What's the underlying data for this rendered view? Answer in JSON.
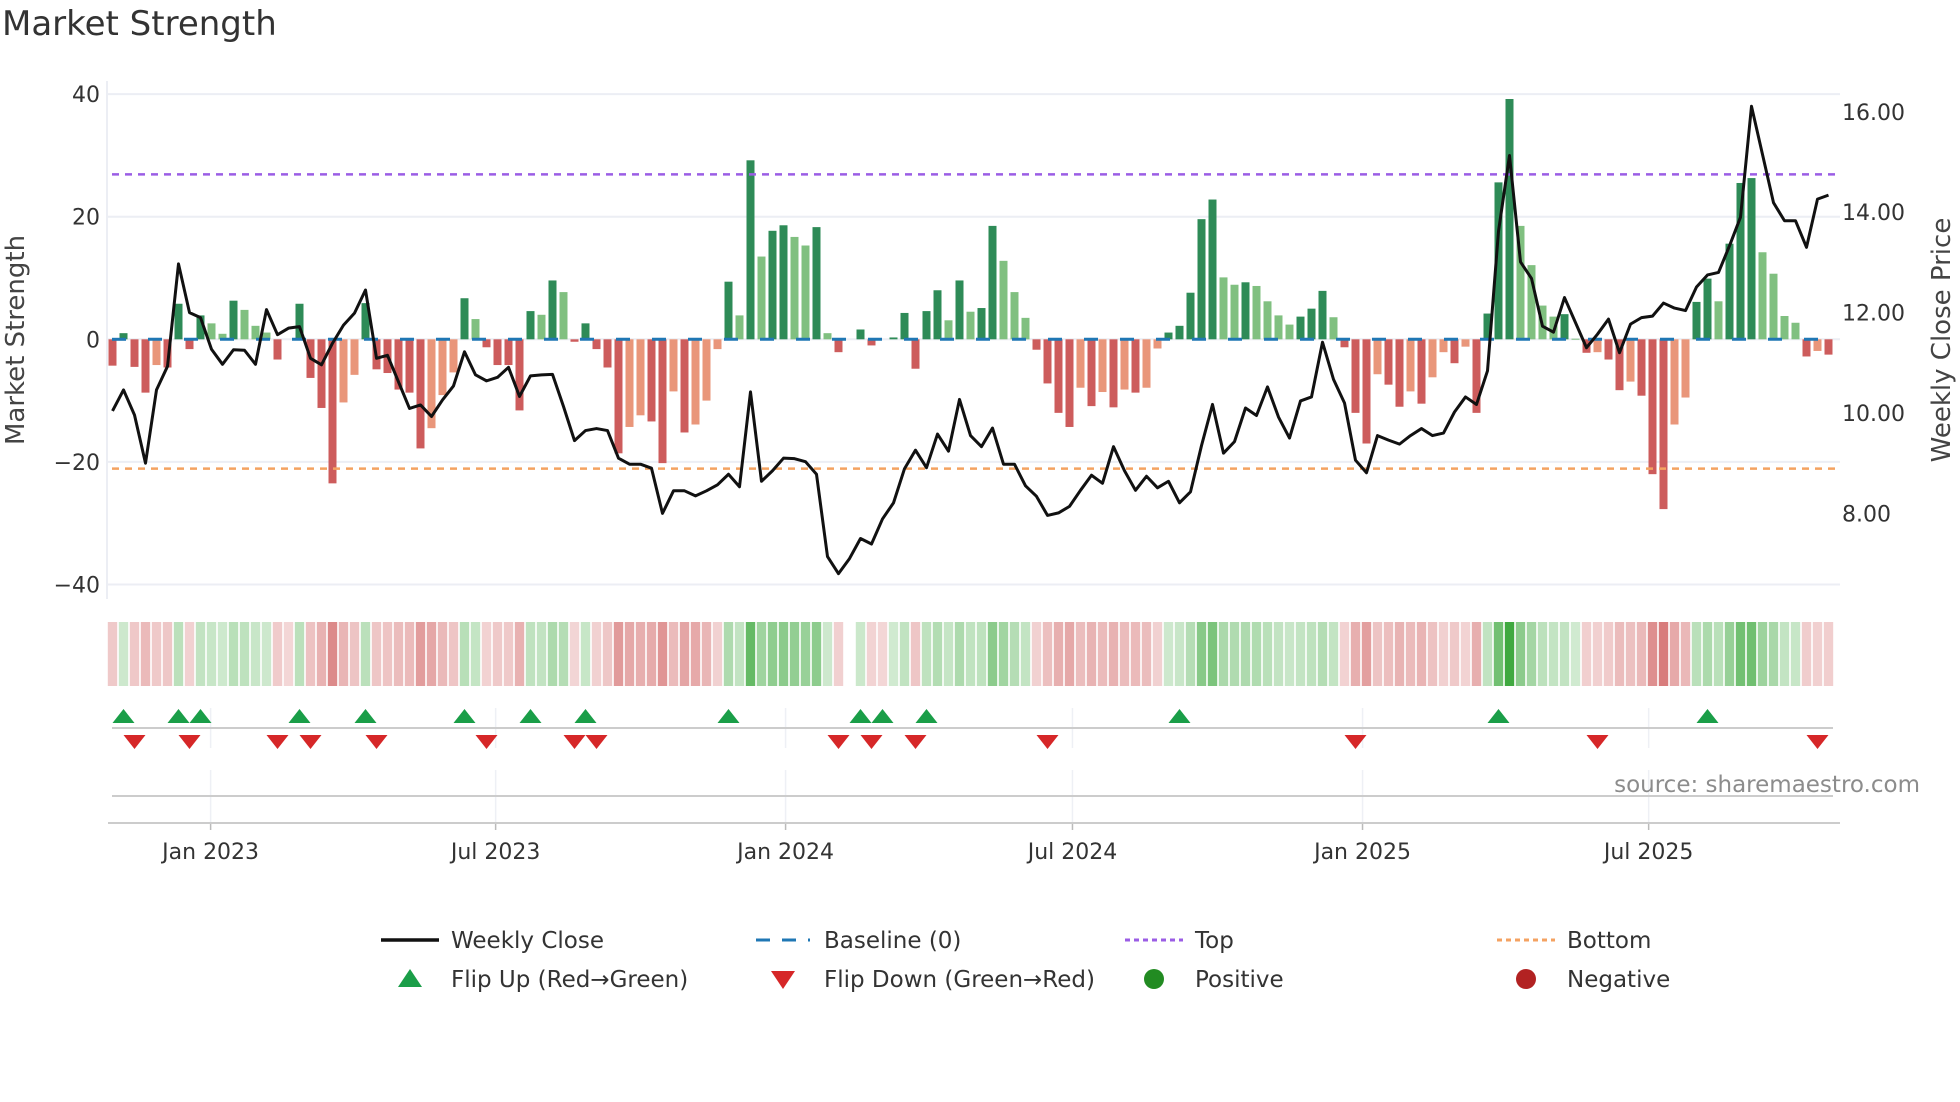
{
  "chart_data": {
    "type": "bar",
    "title": "Market Strength",
    "ylabel": "Market Strength",
    "y2label": "Weekly Close Price",
    "ylim": [
      -43,
      42
    ],
    "y_ticks": [
      40,
      20,
      0,
      -20,
      -40
    ],
    "y_tick_labels": [
      "40",
      "20",
      "0",
      "−20",
      "−40"
    ],
    "y2_ticks": [
      16,
      14,
      12,
      10,
      8
    ],
    "y2_tick_labels": [
      "16.00",
      "14.00",
      "12.00",
      "10.00",
      "8.00"
    ],
    "x_unit": "week index",
    "x_ticks": [
      {
        "label": "Jan 2023",
        "week": 8.92
      },
      {
        "label": "Jul 2023",
        "week": 34.83
      },
      {
        "label": "Jan 2024",
        "week": 61.19
      },
      {
        "label": "Jul 2024",
        "week": 87.27
      },
      {
        "label": "Jan 2025",
        "week": 113.64
      },
      {
        "label": "Jul 2025",
        "week": 139.65
      }
    ],
    "top_level": 26.9,
    "bottom_level": -21.1,
    "baseline": 0,
    "strength": [
      -4.3,
      1.0,
      -4.5,
      -8.7,
      -4.2,
      -4.6,
      5.8,
      -1.6,
      3.9,
      2.6,
      0.9,
      6.3,
      4.8,
      2.2,
      1.1,
      -3.3,
      0,
      5.8,
      -6.3,
      -11.2,
      -23.5,
      -10.3,
      -5.8,
      5.9,
      -4.9,
      -5.5,
      -8.2,
      -8.7,
      -17.8,
      -14.5,
      -9.1,
      -5.4,
      6.7,
      3.3,
      -1.3,
      -4.2,
      -4.2,
      -11.6,
      4.6,
      4.0,
      9.6,
      7.7,
      -0.4,
      2.6,
      -1.6,
      -4.6,
      -18.6,
      -14.3,
      -12.4,
      -13.4,
      -20.2,
      -8.5,
      -15.2,
      -13.9,
      -10.0,
      -1.6,
      9.4,
      3.9,
      29.2,
      13.5,
      17.7,
      18.6,
      16.7,
      15.3,
      18.3,
      1.0,
      -2.1,
      null,
      1.6,
      -1.0,
      0,
      0.3,
      4.3,
      -4.8,
      4.6,
      8.0,
      3.1,
      9.6,
      4.5,
      5.1,
      18.5,
      12.8,
      7.7,
      3.5,
      -1.7,
      -7.2,
      -12.0,
      -14.3,
      -7.9,
      -10.9,
      -8.6,
      -11.1,
      -8.2,
      -8.7,
      -7.9,
      -1.5,
      1.1,
      2.2,
      7.6,
      19.6,
      22.8,
      10.1,
      8.9,
      9.3,
      8.7,
      6.2,
      3.9,
      2.4,
      3.7,
      5.0,
      7.9,
      3.6,
      -1.3,
      -12.0,
      -17.0,
      -5.7,
      -7.4,
      -11.0,
      -8.5,
      -10.5,
      -6.2,
      -2.1,
      -3.9,
      -1.2,
      -12.0,
      4.2,
      25.6,
      39.2,
      18.5,
      12.1,
      5.5,
      3.7,
      4.1,
      0.1,
      -2.2,
      -2.1,
      -3.3,
      -8.3,
      -6.9,
      -9.2,
      -22.0,
      -27.7,
      -13.9,
      -9.5,
      6.1,
      9.9,
      6.2,
      15.6,
      25.5,
      26.3,
      14.2,
      10.7,
      3.8,
      2.7,
      -2.8,
      -1.9,
      -2.5
    ],
    "weekly_close": [
      10.04,
      10.46,
      9.96,
      9.0,
      10.46,
      10.93,
      12.97,
      12.0,
      11.9,
      11.27,
      10.97,
      11.26,
      11.25,
      10.97,
      12.06,
      11.56,
      11.69,
      11.72,
      11.09,
      10.96,
      11.39,
      11.75,
      11.99,
      12.45,
      11.09,
      11.15,
      10.62,
      10.09,
      10.16,
      9.93,
      10.26,
      10.54,
      11.22,
      10.76,
      10.64,
      10.71,
      10.91,
      10.33,
      10.74,
      10.76,
      10.77,
      10.13,
      9.45,
      9.65,
      9.69,
      9.65,
      9.1,
      8.98,
      8.98,
      8.9,
      8.0,
      8.45,
      8.45,
      8.35,
      8.45,
      8.57,
      8.78,
      8.53,
      10.42,
      8.64,
      8.85,
      9.1,
      9.09,
      9.03,
      8.78,
      7.14,
      6.8,
      7.1,
      7.5,
      7.39,
      7.89,
      8.21,
      8.89,
      9.26,
      8.91,
      9.58,
      9.24,
      10.27,
      9.55,
      9.33,
      9.7,
      8.98,
      8.98,
      8.55,
      8.34,
      7.96,
      8.01,
      8.14,
      8.46,
      8.76,
      8.6,
      9.33,
      8.85,
      8.46,
      8.74,
      8.51,
      8.64,
      8.21,
      8.43,
      9.35,
      10.17,
      9.2,
      9.43,
      10.1,
      9.95,
      10.52,
      9.92,
      9.5,
      10.24,
      10.32,
      11.41,
      10.67,
      10.2,
      9.06,
      8.81,
      9.55,
      9.46,
      9.38,
      9.55,
      9.69,
      9.55,
      9.6,
      10.02,
      10.32,
      10.17,
      10.84,
      13.62,
      15.13,
      13.01,
      12.68,
      11.73,
      11.61,
      12.3,
      11.8,
      11.3,
      11.57,
      11.87,
      11.2,
      11.77,
      11.9,
      11.93,
      12.19,
      12.09,
      12.04,
      12.51,
      12.75,
      12.8,
      13.33,
      13.9,
      16.11,
      15.15,
      14.19,
      13.83,
      13.83,
      13.3,
      14.26,
      14.34
    ],
    "flip_up_weeks": [
      1,
      6,
      8,
      17,
      23,
      32,
      38,
      43,
      56,
      68,
      70,
      74,
      97,
      126,
      145
    ],
    "flip_down_weeks": [
      2,
      7,
      15,
      18,
      24,
      34,
      42,
      44,
      66,
      69,
      73,
      85,
      113,
      135,
      155
    ],
    "colors": {
      "rising_positive": "#2e8b57",
      "falling_positive": "#80c080",
      "falling_negative": "#cd5c5c",
      "rising_negative": "#e9967a",
      "close_line": "#111111",
      "baseline": "#1f77b4",
      "top": "#9b5de5",
      "bottom": "#f4a261",
      "flip_up": "#1a9e48",
      "flip_down": "#d62728",
      "positive": "#228b22",
      "negative": "#b22222"
    },
    "legend": [
      {
        "label": "Weekly Close",
        "kind": "line"
      },
      {
        "label": "Baseline (0)",
        "kind": "dash"
      },
      {
        "label": "Top",
        "kind": "dot-top"
      },
      {
        "label": "Bottom",
        "kind": "dot-bottom"
      },
      {
        "label": "Flip Up (Red→Green)",
        "kind": "tri-up"
      },
      {
        "label": "Flip Down (Green→Red)",
        "kind": "tri-down"
      },
      {
        "label": "Positive",
        "kind": "circle-pos"
      },
      {
        "label": "Negative",
        "kind": "circle-neg"
      }
    ],
    "legend_placement": "bottom",
    "source": "source: sharemaestro.com"
  }
}
